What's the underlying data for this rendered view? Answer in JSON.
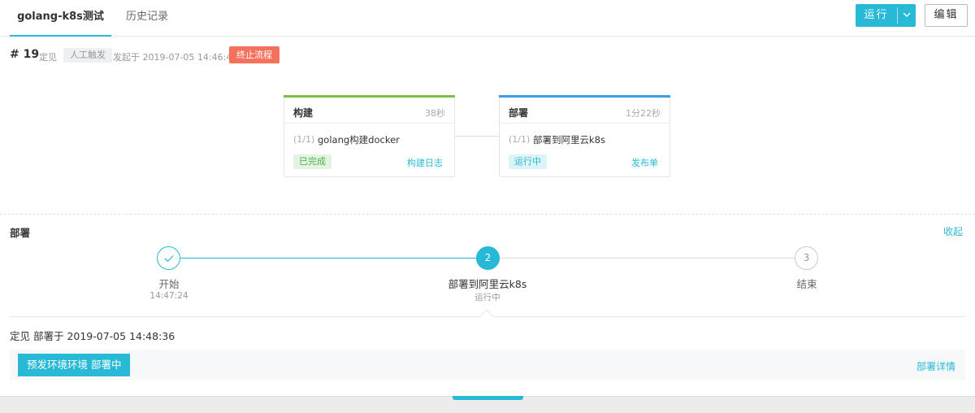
{
  "tabs": [
    {
      "label": "golang-k8s测试",
      "active": true
    },
    {
      "label": "历史记录",
      "active": false
    }
  ],
  "toolbar": {
    "run_label": "运行",
    "edit_label": "编辑"
  },
  "run": {
    "number": "# 19",
    "author": "定见",
    "trigger": "人工触发",
    "started": "发起于 2019-07-05 14:46:45",
    "stop_label": "终止流程"
  },
  "stages": [
    {
      "name": "构建",
      "duration": "38秒",
      "job_index": "(1/1)",
      "job_name": "golang构建docker",
      "status": "已完成",
      "link": "构建日志",
      "color": "#7ac143"
    },
    {
      "name": "部署",
      "duration": "1分22秒",
      "job_index": "(1/1)",
      "job_name": "部署到阿里云k8s",
      "status": "运行中",
      "link": "发布单",
      "color": "#3a9fe0"
    }
  ],
  "deploy": {
    "title": "部署",
    "collapse_label": "收起",
    "steps": [
      {
        "marker": "✓",
        "label": "开始",
        "sub": "14:47:24",
        "state": "done"
      },
      {
        "marker": "2",
        "label": "部署到阿里云k8s",
        "sub": "运行中",
        "state": "active"
      },
      {
        "marker": "3",
        "label": "结束",
        "sub": "",
        "state": "pending"
      }
    ],
    "info": "定见  部署于  2019-07-05 14:48:36",
    "env_status": "预发环境环境 部署中",
    "detail_link": "部署详情"
  },
  "colors": {
    "accent": "#27b9d6",
    "stop": "#f4715c",
    "done_bg": "#e3f4e0",
    "done_text": "#4caf50",
    "running_bg": "#dcf3f8"
  }
}
